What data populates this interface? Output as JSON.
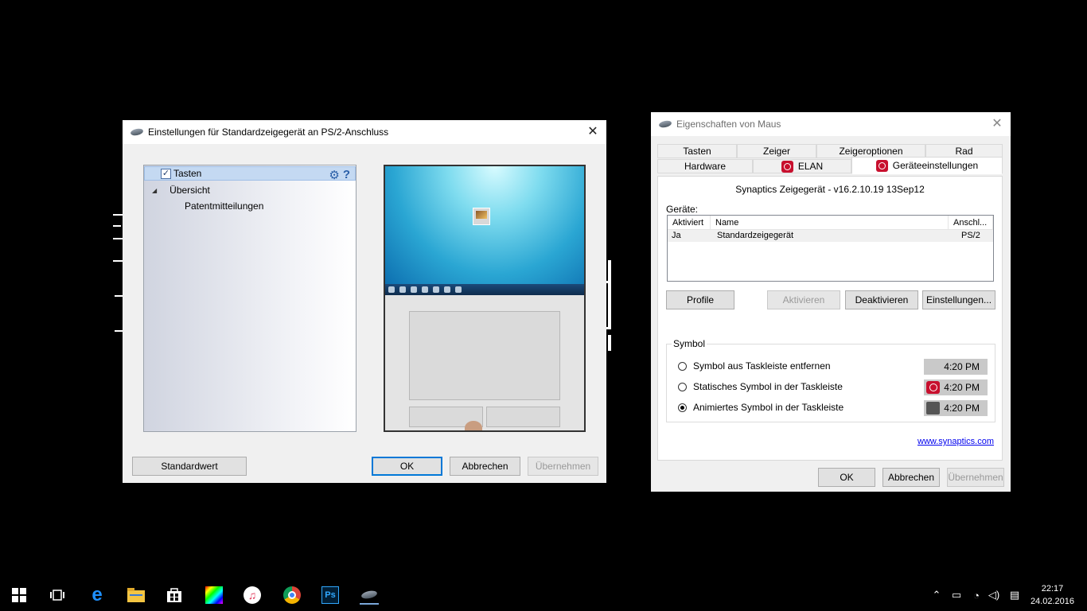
{
  "window1": {
    "title": "Einstellungen für Standardzeigegerät an PS/2-Anschluss",
    "tree": [
      {
        "label": "Tasten",
        "checked": true
      },
      {
        "label": "Übersicht"
      },
      {
        "label": "Patentmitteilungen"
      }
    ],
    "tools": {
      "gear": "⚙",
      "help": "?"
    },
    "buttons": {
      "default": "Standardwert",
      "ok": "OK",
      "cancel": "Abbrechen",
      "apply": "Übernehmen"
    }
  },
  "window2": {
    "title": "Eigenschaften von Maus",
    "tabs_row1": [
      "Tasten",
      "Zeiger",
      "Zeigeroptionen",
      "Rad"
    ],
    "tabs_row2": [
      "Hardware",
      "ELAN",
      "Geräteeinstellungen"
    ],
    "device_version": "Synaptics Zeigegerät - v16.2.10.19 13Sep12",
    "devices_label": "Geräte:",
    "columns": [
      "Aktiviert",
      "Name",
      "Anschl..."
    ],
    "rows": [
      {
        "enabled": "Ja",
        "name": "Standardzeigegerät",
        "port": "PS/2"
      }
    ],
    "device_buttons": {
      "profiles": "Profile",
      "activate": "Aktivieren",
      "deactivate": "Deaktivieren",
      "settings": "Einstellungen..."
    },
    "symbol": {
      "legend": "Symbol",
      "options": [
        {
          "label": "Symbol aus Taskleiste entfernen",
          "selected": false,
          "time": "4:20 PM"
        },
        {
          "label": "Statisches Symbol in der Taskleiste",
          "selected": false,
          "time": "4:20 PM"
        },
        {
          "label": "Animiertes Symbol in der Taskleiste",
          "selected": true,
          "time": "4:20 PM"
        }
      ]
    },
    "link": "www.synaptics.com",
    "buttons": {
      "ok": "OK",
      "cancel": "Abbrechen",
      "apply": "Übernehmen"
    }
  },
  "taskbar": {
    "time": "22:17",
    "date": "24.02.2016"
  }
}
